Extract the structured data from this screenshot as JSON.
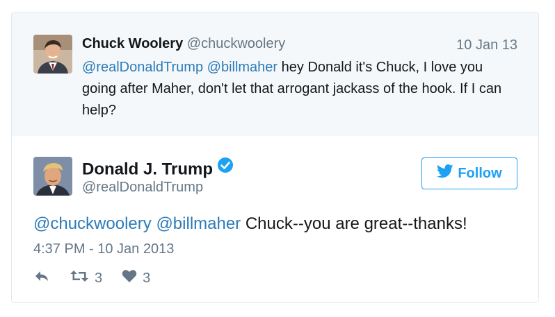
{
  "parent_tweet": {
    "name": "Chuck Woolery",
    "handle": "@chuckwoolery",
    "date": "10 Jan 13",
    "mention1": "@realDonaldTrump",
    "mention2": "@billmaher",
    "text": " hey Donald it's Chuck, I love you going after Maher, don't let that arrogant jackass of the hook. If I can help?"
  },
  "main_tweet": {
    "name": "Donald J. Trump",
    "handle": "@realDonaldTrump",
    "follow_label": "Follow",
    "mention1": "@chuckwoolery",
    "mention2": "@billmaher",
    "text": " Chuck--you are great--thanks!",
    "timestamp": "4:37 PM - 10 Jan 2013",
    "retweets": "3",
    "likes": "3"
  },
  "icons": {
    "verified": "verified-badge-icon",
    "bird": "twitter-bird-icon",
    "reply": "reply-icon",
    "retweet": "retweet-icon",
    "like": "heart-icon"
  },
  "colors": {
    "link": "#2b7bb9",
    "twitter_blue": "#1da1f2",
    "muted": "#657786",
    "parent_bg": "#f5f8fa"
  }
}
